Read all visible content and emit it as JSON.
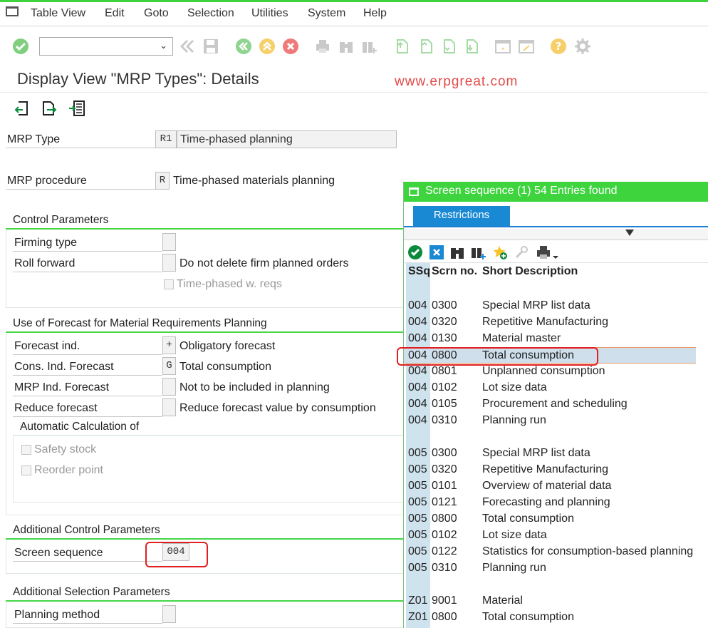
{
  "menu": [
    "Table View",
    "Edit",
    "Goto",
    "Selection",
    "Utilities",
    "System",
    "Help"
  ],
  "title": "Display View \"MRP Types\": Details",
  "watermark": "www.erpgreat.com",
  "fields": {
    "mrp_type": {
      "label": "MRP Type",
      "code": "R1",
      "text": "Time-phased planning"
    },
    "mrp_procedure": {
      "label": "MRP procedure",
      "code": "R",
      "text": "Time-phased materials planning"
    }
  },
  "control": {
    "title": "Control Parameters",
    "firming": {
      "label": "Firming type",
      "code": ""
    },
    "roll": {
      "label": "Roll forward",
      "code": "",
      "text": "Do not delete firm planned orders"
    },
    "timephased": "Time-phased w. reqs"
  },
  "forecast": {
    "title": "Use of Forecast for Material Requirements Planning",
    "rows": [
      {
        "label": "Forecast ind.",
        "code": "+",
        "text": "Obligatory forecast"
      },
      {
        "label": "Cons. Ind. Forecast",
        "code": "G",
        "text": "Total consumption"
      },
      {
        "label": "MRP Ind. Forecast",
        "code": "",
        "text": "Not to be included in planning"
      },
      {
        "label": "Reduce forecast",
        "code": "",
        "text": "Reduce forecast value by consumption"
      }
    ],
    "auto": {
      "title": "Automatic Calculation of",
      "safety": "Safety stock",
      "reorder": "Reorder point"
    }
  },
  "additional": {
    "title": "Additional Control Parameters",
    "label": "Screen sequence",
    "code": "004"
  },
  "selection": {
    "title": "Additional Selection Parameters",
    "label": "Planning method",
    "code": ""
  },
  "popup": {
    "title": "Screen sequence (1)   54 Entries found",
    "tab": "Restrictions",
    "headers": [
      "SSq",
      "Scrn no.",
      "Short Description"
    ],
    "rows": [
      {
        "ssq": "004",
        "scrn": "0300",
        "desc": "Special MRP list data"
      },
      {
        "ssq": "004",
        "scrn": "0320",
        "desc": "Repetitive Manufacturing"
      },
      {
        "ssq": "004",
        "scrn": "0130",
        "desc": "Material master"
      },
      {
        "ssq": "004",
        "scrn": "0800",
        "desc": "Total consumption"
      },
      {
        "ssq": "004",
        "scrn": "0801",
        "desc": "Unplanned consumption"
      },
      {
        "ssq": "004",
        "scrn": "0102",
        "desc": "Lot size data"
      },
      {
        "ssq": "004",
        "scrn": "0105",
        "desc": "Procurement and scheduling"
      },
      {
        "ssq": "004",
        "scrn": "0310",
        "desc": "Planning run"
      },
      {
        "ssq": "005",
        "scrn": "0300",
        "desc": "Special MRP list data"
      },
      {
        "ssq": "005",
        "scrn": "0320",
        "desc": "Repetitive Manufacturing"
      },
      {
        "ssq": "005",
        "scrn": "0101",
        "desc": "Overview of material data"
      },
      {
        "ssq": "005",
        "scrn": "0121",
        "desc": "Forecasting and planning"
      },
      {
        "ssq": "005",
        "scrn": "0800",
        "desc": "Total consumption"
      },
      {
        "ssq": "005",
        "scrn": "0102",
        "desc": "Lot size data"
      },
      {
        "ssq": "005",
        "scrn": "0122",
        "desc": "Statistics for consumption-based planning"
      },
      {
        "ssq": "005",
        "scrn": "0310",
        "desc": "Planning run"
      },
      {
        "ssq": "Z01",
        "scrn": "9001",
        "desc": "Material"
      },
      {
        "ssq": "Z01",
        "scrn": "0800",
        "desc": "Total consumption"
      }
    ]
  },
  "colors": {
    "sap_green": "#3dd43d",
    "tab_blue": "#1a89d4",
    "highlight_red": "#e01f1f"
  }
}
